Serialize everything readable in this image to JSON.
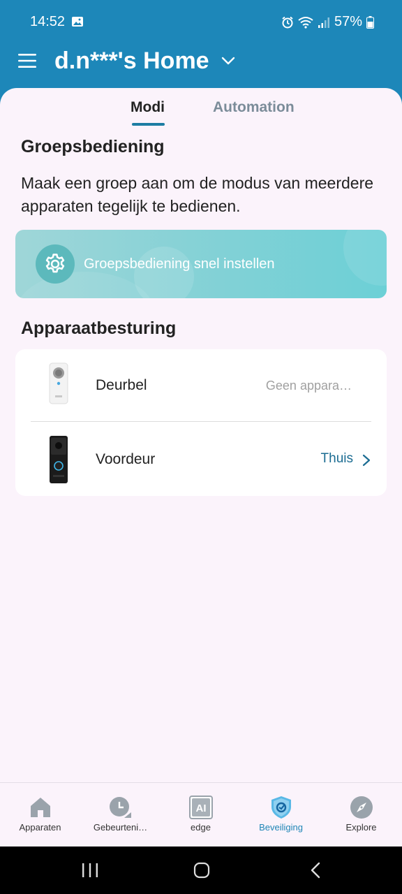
{
  "status_bar": {
    "time": "14:52",
    "battery": "57%"
  },
  "header": {
    "home_title": "d.n***'s Home"
  },
  "tabs": {
    "modi": "Modi",
    "automation": "Automation"
  },
  "group_control": {
    "title": "Groepsbediening",
    "description": "Maak een groep aan om de modus van meerdere apparaten tegelijk te bedienen.",
    "banner_label": "Groepsbediening snel instellen"
  },
  "device_control": {
    "title": "Apparaatbesturing",
    "devices": [
      {
        "name": "Deurbel",
        "status": "Geen appara…"
      },
      {
        "name": "Voordeur",
        "status": "Thuis"
      }
    ]
  },
  "bottom_nav": {
    "items": [
      {
        "label": "Apparaten"
      },
      {
        "label": "Gebeurteni…"
      },
      {
        "label": "edge"
      },
      {
        "label": "Beveiliging"
      },
      {
        "label": "Explore"
      }
    ],
    "edge_icon_text": "AI"
  },
  "colors": {
    "header_bg": "#1d87b9",
    "accent": "#1d7da3",
    "sheet_bg": "#fbf3fb",
    "banner": "#82d1d6"
  }
}
